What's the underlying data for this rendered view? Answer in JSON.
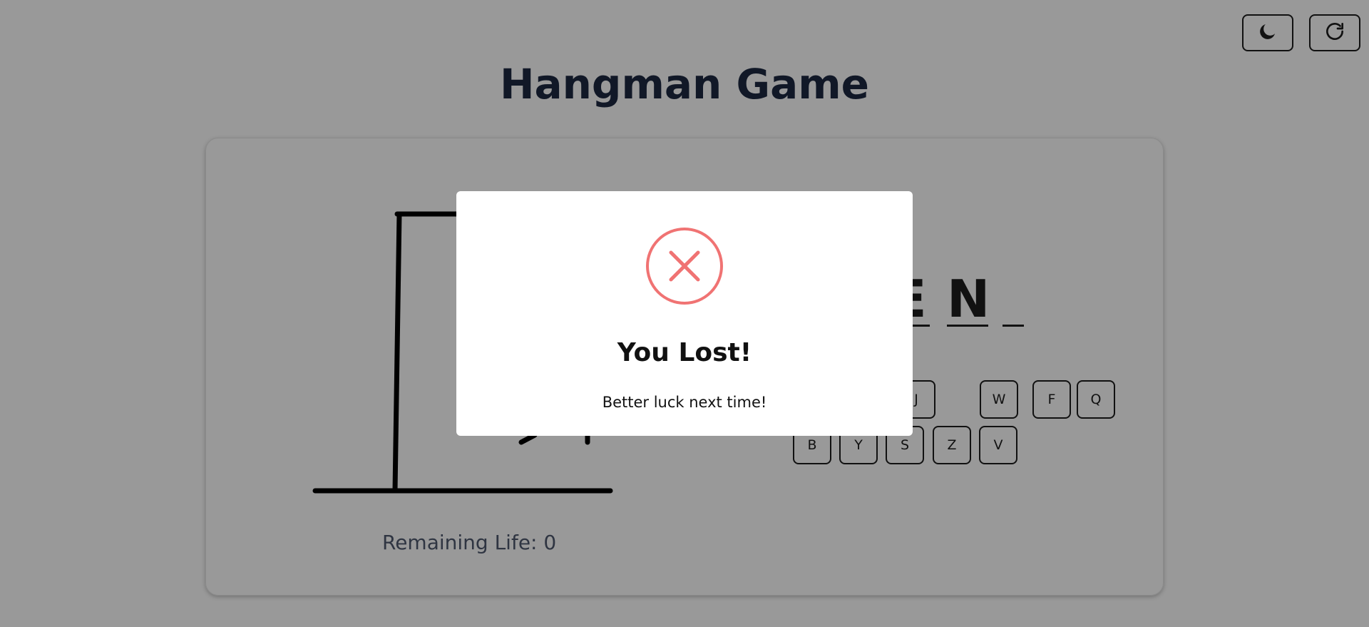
{
  "header": {
    "title": "Hangman Game",
    "theme_toggle_icon": "moon-icon",
    "reset_icon": "refresh-icon"
  },
  "game": {
    "remaining_life_text": "Remaining Life: 0",
    "word_letters": [
      "E",
      "N",
      ""
    ],
    "keys": [
      "J",
      "W",
      "F",
      "Q",
      "B",
      "Y",
      "S",
      "Z",
      "V"
    ]
  },
  "modal": {
    "icon": "x-circle-icon",
    "title": "You Lost!",
    "message": "Better luck next time!"
  },
  "colors": {
    "overlay_background": "#999999",
    "error_accent": "#f07373",
    "title_color": "#111827"
  }
}
